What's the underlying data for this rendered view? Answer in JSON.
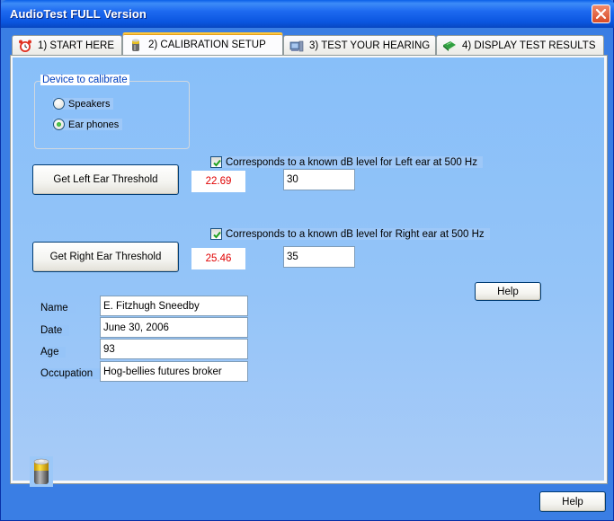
{
  "window": {
    "title": "AudioTest FULL Version",
    "close_icon": "close-icon"
  },
  "tabs": [
    {
      "label": "1) START HERE",
      "icon": "alarm-clock-icon",
      "active": false
    },
    {
      "label": "2) CALIBRATION SETUP",
      "icon": "battery-icon",
      "active": true
    },
    {
      "label": "3) TEST YOUR HEARING",
      "icon": "computer-speaker-icon",
      "active": false
    },
    {
      "label": "4) DISPLAY TEST RESULTS",
      "icon": "green-book-icon",
      "active": false
    }
  ],
  "calibration": {
    "device_group_label": "Device to calibrate",
    "device_options": [
      {
        "label": "Speakers",
        "selected": false
      },
      {
        "label": "Ear phones",
        "selected": true
      }
    ],
    "left": {
      "button_label": "Get Left Ear Threshold",
      "checkbox_label": "Corresponds to a known dB level for Left ear at 500 Hz",
      "checked": true,
      "threshold_value": "22.69",
      "known_db_value": "30"
    },
    "right": {
      "button_label": "Get Right Ear Threshold",
      "checkbox_label": "Corresponds to a known dB level for Right ear at 500 Hz",
      "checked": true,
      "threshold_value": "25.46",
      "known_db_value": "35"
    },
    "help_label": "Help"
  },
  "person": {
    "fields": [
      {
        "label": "Name",
        "value": "E. Fitzhugh Sneedby"
      },
      {
        "label": "Date",
        "value": "June 30, 2006"
      },
      {
        "label": "Age",
        "value": "93"
      },
      {
        "label": "Occupation",
        "value": "Hog-bellies futures broker"
      }
    ]
  },
  "footer": {
    "help_label": "Help"
  },
  "colors": {
    "threshold_text": "#e00000",
    "panel_bg": "#94c4f8",
    "window_frame": "#3a7ee4",
    "active_tab_highlight": "#ffc83c"
  }
}
